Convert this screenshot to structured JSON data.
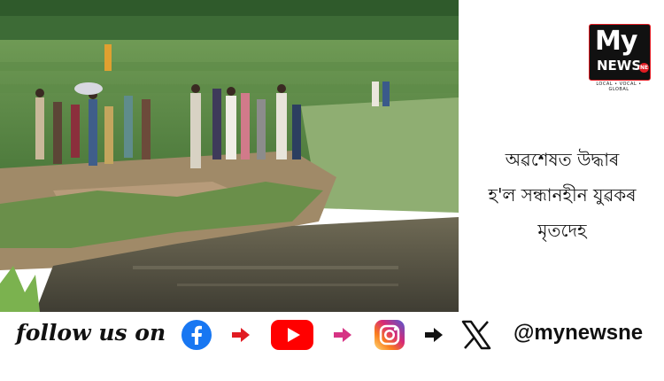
{
  "headline": {
    "line1": "অৱশেষত উদ্ধাৰ",
    "line2": "হ'ল সন্ধানহীন যুৱকৰ",
    "line3": "মৃতদেহ"
  },
  "logo": {
    "my": "My",
    "news": "NEWS",
    "badge": "NE",
    "tagline": "LOCAL • VOCAL • GLOBAL"
  },
  "follow": {
    "label": "follow us on",
    "handle": "@mynewsne"
  },
  "icons": [
    "facebook-icon",
    "arrow-right-icon",
    "youtube-icon",
    "arrow-right-icon",
    "instagram-icon",
    "arrow-right-icon",
    "x-icon"
  ],
  "colors": {
    "facebook": "#1877f2",
    "youtube": "#ff0000",
    "arrow_red": "#e11b22",
    "arrow_pink": "#d63384",
    "arrow_black": "#111111"
  }
}
